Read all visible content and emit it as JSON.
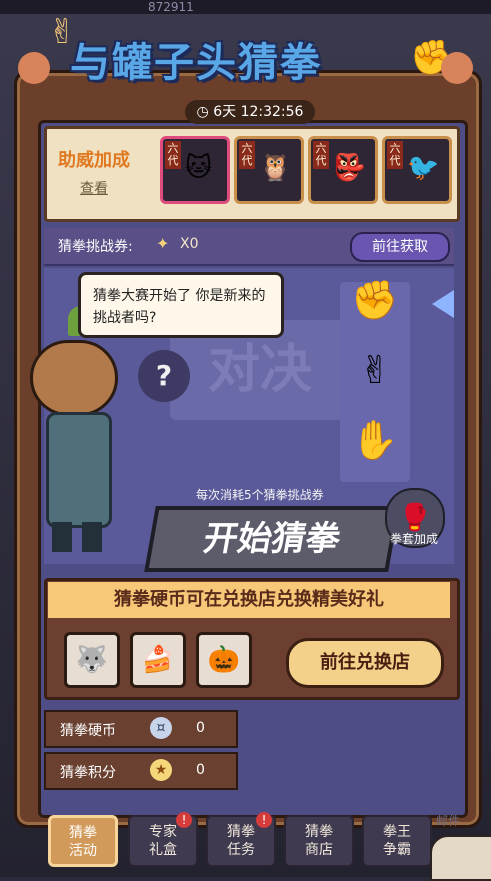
{
  "top_strip": {
    "value": "872911"
  },
  "title": "与罐子头猜拳",
  "timer": "6天 12:32:56",
  "support": {
    "label": "助威加成",
    "link": "查看",
    "cards": [
      {
        "tag": "六代",
        "icon": "character-white-cat-icon",
        "accent": "#e04b7d"
      },
      {
        "tag": "六代",
        "icon": "character-brown-owl-icon",
        "accent": "#c8904a"
      },
      {
        "tag": "六代",
        "icon": "character-red-mask-icon",
        "accent": "#c8904a"
      },
      {
        "tag": "六代",
        "icon": "character-dark-bird-icon",
        "accent": "#c8904a"
      }
    ]
  },
  "ticket": {
    "label": "猜拳挑战券:",
    "count": "X0",
    "button": "前往获取"
  },
  "arena": {
    "speech": "猜拳大赛开始了 你是新来的挑战者吗?",
    "bg_text": "对决",
    "question": "?",
    "hands": [
      {
        "name": "rock",
        "glyph": "✊"
      },
      {
        "name": "scissors",
        "glyph": "✌"
      },
      {
        "name": "paper",
        "glyph": "✋"
      }
    ],
    "cost": "每次消耗5个猜拳挑战券",
    "start": "开始猜拳",
    "glove_label": "拳套加成"
  },
  "shop": {
    "title": "猜拳硬币可在兑换店兑换精美好礼",
    "rewards": [
      {
        "icon": "avatar-frame-icon",
        "glyph": "🐺"
      },
      {
        "icon": "cake-icon",
        "glyph": "🍰"
      },
      {
        "icon": "character-icon",
        "glyph": "🎃"
      }
    ],
    "button": "前往兑换店"
  },
  "stats": [
    {
      "label": "猜拳硬币",
      "value": "0",
      "icon": "coin-icon"
    },
    {
      "label": "猜拳积分",
      "value": "0",
      "icon": "star-icon"
    }
  ],
  "tabs": [
    {
      "line1": "猜拳",
      "line2": "活动",
      "active": true,
      "badge": ""
    },
    {
      "line1": "专家",
      "line2": "礼盒",
      "active": false,
      "badge": "!"
    },
    {
      "line1": "猜拳",
      "line2": "任务",
      "active": false,
      "badge": "!"
    },
    {
      "line1": "猜拳",
      "line2": "商店",
      "active": false,
      "badge": ""
    },
    {
      "line1": "拳王",
      "line2": "争霸",
      "active": false,
      "badge": ""
    }
  ],
  "mail": "邮件"
}
